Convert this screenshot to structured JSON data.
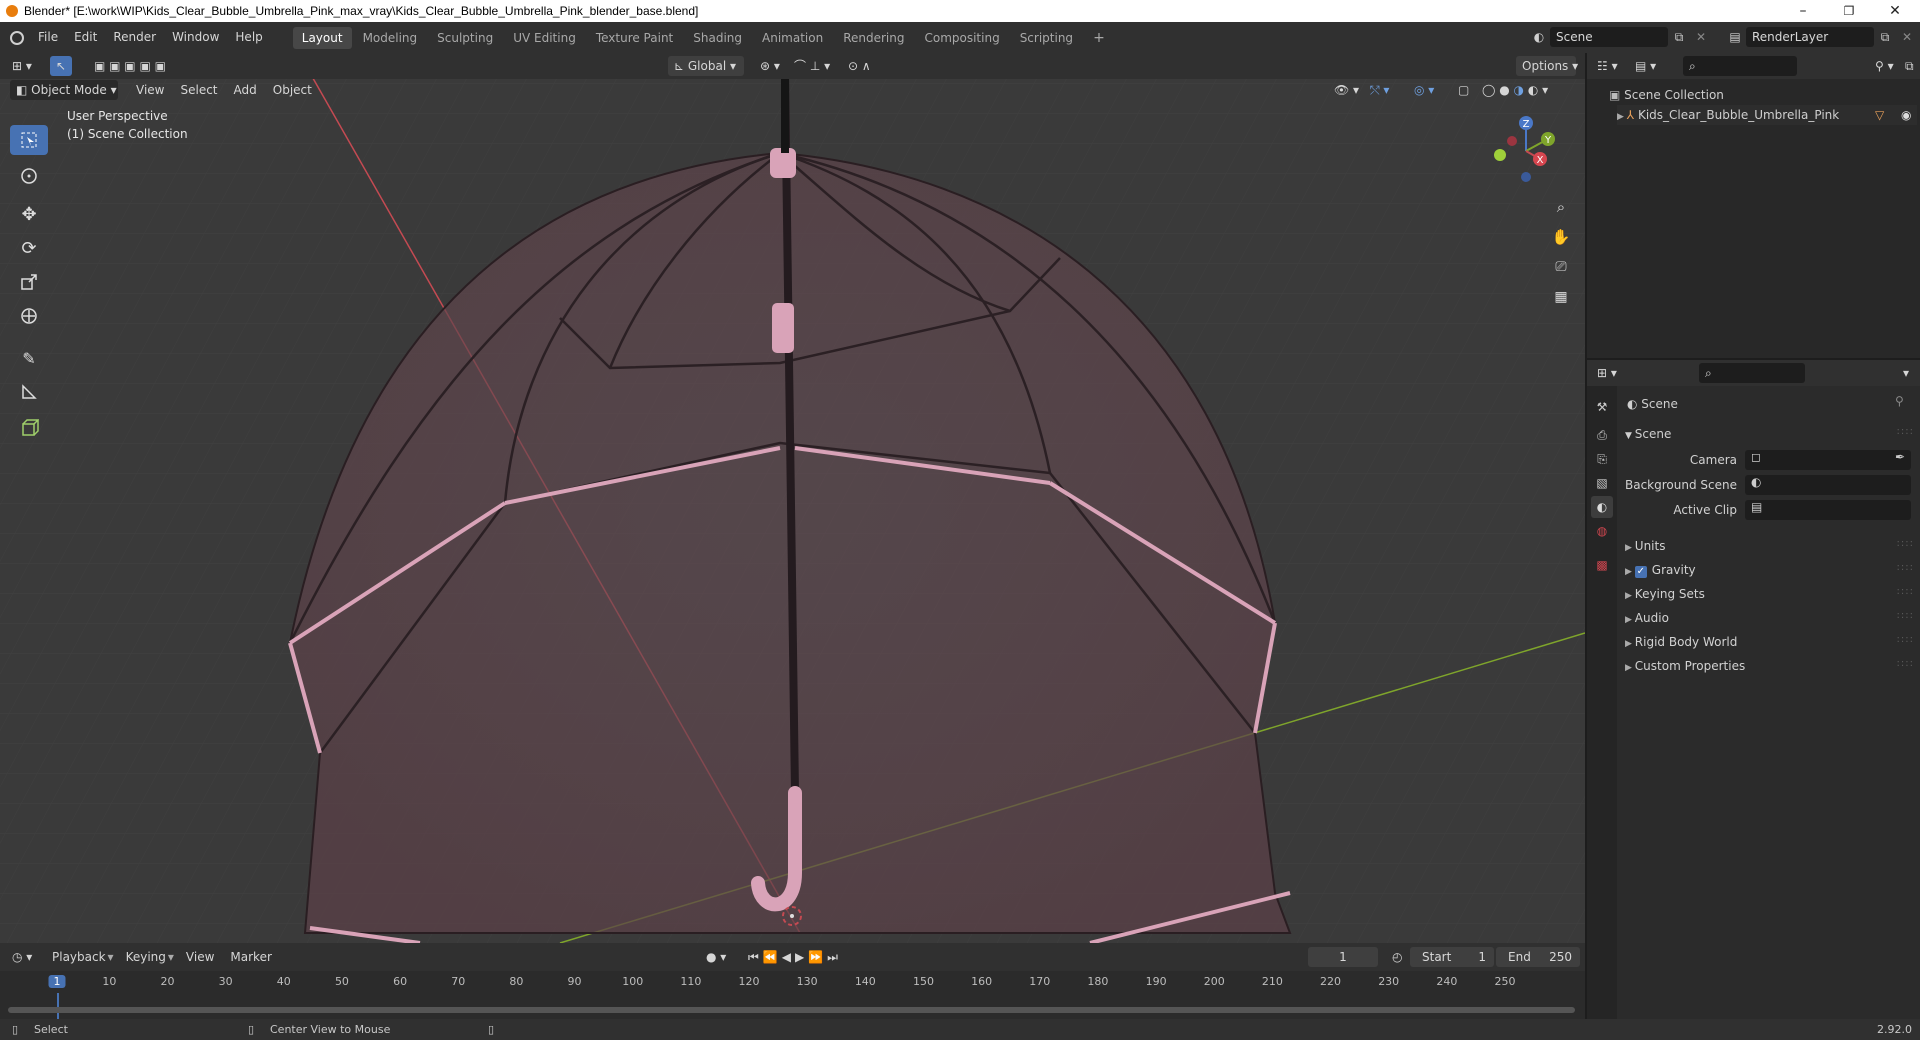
{
  "window": {
    "title": "Blender* [E:\\work\\WIP\\Kids_Clear_Bubble_Umbrella_Pink_max_vray\\Kids_Clear_Bubble_Umbrella_Pink_blender_base.blend]",
    "minimize": "–",
    "restore": "❐",
    "close": "✕"
  },
  "menubar": {
    "items": [
      "File",
      "Edit",
      "Render",
      "Window",
      "Help"
    ]
  },
  "workspaces": {
    "tabs": [
      "Layout",
      "Modeling",
      "Sculpting",
      "UV Editing",
      "Texture Paint",
      "Shading",
      "Animation",
      "Rendering",
      "Compositing",
      "Scripting"
    ],
    "active": "Layout",
    "add": "+"
  },
  "scene_selector": {
    "value": "Scene"
  },
  "layer_selector": {
    "value": "RenderLayer"
  },
  "viewport_header": {
    "transform_orientation": "Global",
    "options": "Options",
    "mode": "Object Mode",
    "menus": [
      "View",
      "Select",
      "Add",
      "Object"
    ]
  },
  "viewport": {
    "perspective": "User Perspective",
    "collection": "(1) Scene Collection",
    "gizmo": {
      "z": "Z",
      "y": "Y",
      "x": "X"
    }
  },
  "outliner": {
    "root": "Scene Collection",
    "items": [
      {
        "label": "Kids_Clear_Bubble_Umbrella_Pink"
      }
    ]
  },
  "properties": {
    "context": "Scene",
    "panel_title": "Scene",
    "fields": [
      {
        "label": "Camera"
      },
      {
        "label": "Background Scene"
      },
      {
        "label": "Active Clip"
      }
    ],
    "sections": [
      {
        "label": "Units",
        "checkbox": false
      },
      {
        "label": "Gravity",
        "checkbox": true
      },
      {
        "label": "Keying Sets",
        "checkbox": false
      },
      {
        "label": "Audio",
        "checkbox": false
      },
      {
        "label": "Rigid Body World",
        "checkbox": false
      },
      {
        "label": "Custom Properties",
        "checkbox": false
      }
    ]
  },
  "timeline": {
    "menus": [
      "Playback",
      "Keying",
      "View",
      "Marker"
    ],
    "current_frame": "1",
    "start_label": "Start",
    "start": "1",
    "end_label": "End",
    "end": "250",
    "ticks": [
      "1",
      "10",
      "20",
      "30",
      "40",
      "50",
      "60",
      "70",
      "80",
      "90",
      "100",
      "110",
      "120",
      "130",
      "140",
      "150",
      "160",
      "170",
      "180",
      "190",
      "200",
      "210",
      "220",
      "230",
      "240",
      "250"
    ]
  },
  "statusbar": {
    "left": "Select",
    "middle": "Center View to Mouse",
    "version": "2.92.0"
  },
  "colors": {
    "accent": "#4772b3",
    "umbrella_pink": "#d9a3b8",
    "x_axis": "#d6464f",
    "y_axis": "#7fa52b"
  }
}
